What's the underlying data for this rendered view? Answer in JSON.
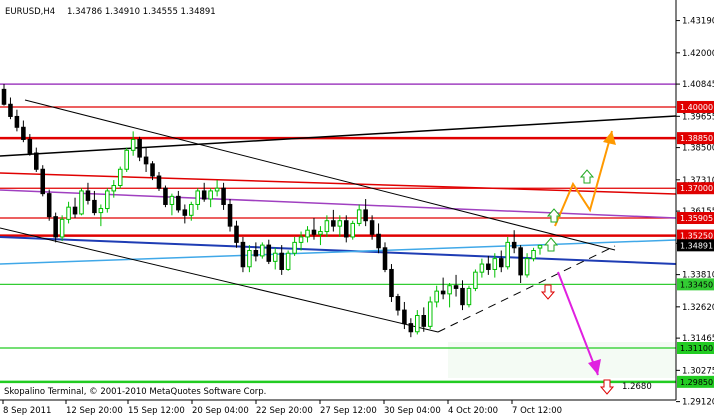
{
  "window": {
    "symbol_tf": "EURUSD,H4",
    "ohlc": "1.34786 1.34910 1.34555 1.34891",
    "copyright": "Skopalino Terminal, © 2001-2010 MetaQuotes Software Corp."
  },
  "colors": {
    "background": "#ffffff",
    "axis": "#000000",
    "bull_candle": "#00c000",
    "bear_candle": "#000000",
    "resistance_red": "#e00000",
    "purple_channel": "#a040c0",
    "blue_line": "#1e3cb4",
    "light_blue_line": "#40a8e8",
    "support_green": "#33cc33",
    "bold_green": "#22cc22",
    "orange_path": "#ff9900",
    "magenta_path": "#e020e0",
    "green_arrow": "#22aa22",
    "red_arrow": "#dd0000",
    "target_zone_fill": "#f4fbf4"
  },
  "chart_data": {
    "type": "candlestick",
    "symbol": "EURUSD",
    "timeframe": "H4",
    "ylim": [
      1.2918,
      1.4395
    ],
    "y_ticks": [
      "1.43190",
      "1.42000",
      "1.40845",
      "1.39655",
      "1.38500",
      "1.37310",
      "1.36155",
      "1.34965",
      "1.33810",
      "1.32620",
      "1.31465",
      "1.30275",
      "1.29120"
    ],
    "x_ticks": [
      "8 Sep 2011",
      "12 Sep 20:00",
      "15 Sep 12:00",
      "20 Sep 04:00",
      "22 Sep 20:00",
      "27 Sep 12:00",
      "30 Sep 04:00",
      "4 Oct 20:00",
      "7 Oct 12:00"
    ],
    "candles": [
      [
        1.4065,
        1.4085,
        1.4005,
        1.401
      ],
      [
        1.401,
        1.4035,
        1.3955,
        1.3965
      ],
      [
        1.3965,
        1.399,
        1.391,
        1.3925
      ],
      [
        1.3925,
        1.395,
        1.387,
        1.388
      ],
      [
        1.388,
        1.39,
        1.382,
        1.383
      ],
      [
        1.383,
        1.385,
        1.376,
        1.377
      ],
      [
        1.377,
        1.3785,
        1.367,
        1.368
      ],
      [
        1.368,
        1.3695,
        1.358,
        1.3595
      ],
      [
        1.3595,
        1.361,
        1.35,
        1.352
      ],
      [
        1.352,
        1.36,
        1.3505,
        1.3585
      ],
      [
        1.3585,
        1.365,
        1.357,
        1.363
      ],
      [
        1.363,
        1.3665,
        1.359,
        1.3605
      ],
      [
        1.3605,
        1.37,
        1.36,
        1.369
      ],
      [
        1.369,
        1.372,
        1.364,
        1.3655
      ],
      [
        1.3655,
        1.369,
        1.36,
        1.361
      ],
      [
        1.361,
        1.364,
        1.356,
        1.3625
      ],
      [
        1.3625,
        1.37,
        1.361,
        1.369
      ],
      [
        1.369,
        1.373,
        1.3665,
        1.371
      ],
      [
        1.371,
        1.378,
        1.37,
        1.377
      ],
      [
        1.377,
        1.385,
        1.376,
        1.384
      ],
      [
        1.384,
        1.391,
        1.382,
        1.388
      ],
      [
        1.388,
        1.389,
        1.38,
        1.3815
      ],
      [
        1.3815,
        1.385,
        1.376,
        1.379
      ],
      [
        1.379,
        1.38,
        1.373,
        1.3745
      ],
      [
        1.3745,
        1.376,
        1.369,
        1.37
      ],
      [
        1.37,
        1.371,
        1.363,
        1.364
      ],
      [
        1.364,
        1.368,
        1.36,
        1.367
      ],
      [
        1.367,
        1.369,
        1.361,
        1.362
      ],
      [
        1.362,
        1.364,
        1.357,
        1.36
      ],
      [
        1.36,
        1.365,
        1.358,
        1.364
      ],
      [
        1.364,
        1.37,
        1.362,
        1.369
      ],
      [
        1.369,
        1.372,
        1.365,
        1.366
      ],
      [
        1.366,
        1.37,
        1.363,
        1.369
      ],
      [
        1.369,
        1.373,
        1.367,
        1.37
      ],
      [
        1.37,
        1.372,
        1.362,
        1.364
      ],
      [
        1.364,
        1.366,
        1.354,
        1.356
      ],
      [
        1.356,
        1.358,
        1.348,
        1.35
      ],
      [
        1.35,
        1.352,
        1.339,
        1.341
      ],
      [
        1.341,
        1.349,
        1.339,
        1.347
      ],
      [
        1.347,
        1.35,
        1.343,
        1.345
      ],
      [
        1.345,
        1.35,
        1.344,
        1.349
      ],
      [
        1.349,
        1.351,
        1.342,
        1.343
      ],
      [
        1.343,
        1.348,
        1.34,
        1.346
      ],
      [
        1.346,
        1.349,
        1.338,
        1.34
      ],
      [
        1.34,
        1.347,
        1.3395,
        1.346
      ],
      [
        1.346,
        1.352,
        1.345,
        1.35
      ],
      [
        1.35,
        1.354,
        1.347,
        1.352
      ],
      [
        1.352,
        1.356,
        1.35,
        1.3545
      ],
      [
        1.3545,
        1.359,
        1.351,
        1.353
      ],
      [
        1.353,
        1.356,
        1.349,
        1.354
      ],
      [
        1.354,
        1.36,
        1.352,
        1.358
      ],
      [
        1.358,
        1.362,
        1.354,
        1.356
      ],
      [
        1.356,
        1.36,
        1.352,
        1.358
      ],
      [
        1.358,
        1.36,
        1.35,
        1.352
      ],
      [
        1.352,
        1.358,
        1.351,
        1.357
      ],
      [
        1.357,
        1.364,
        1.356,
        1.362
      ],
      [
        1.362,
        1.366,
        1.356,
        1.358
      ],
      [
        1.358,
        1.36,
        1.351,
        1.353
      ],
      [
        1.353,
        1.357,
        1.346,
        1.348
      ],
      [
        1.348,
        1.35,
        1.339,
        1.34
      ],
      [
        1.34,
        1.342,
        1.328,
        1.33
      ],
      [
        1.33,
        1.331,
        1.323,
        1.325
      ],
      [
        1.325,
        1.328,
        1.318,
        1.32
      ],
      [
        1.32,
        1.322,
        1.315,
        1.317
      ],
      [
        1.317,
        1.325,
        1.316,
        1.323
      ],
      [
        1.323,
        1.326,
        1.317,
        1.319
      ],
      [
        1.319,
        1.33,
        1.318,
        1.328
      ],
      [
        1.328,
        1.334,
        1.326,
        1.332
      ],
      [
        1.332,
        1.337,
        1.329,
        1.331
      ],
      [
        1.331,
        1.335,
        1.326,
        1.334
      ],
      [
        1.334,
        1.338,
        1.33,
        1.333
      ],
      [
        1.333,
        1.336,
        1.325,
        1.327
      ],
      [
        1.327,
        1.334,
        1.326,
        1.333
      ],
      [
        1.333,
        1.34,
        1.332,
        1.339
      ],
      [
        1.339,
        1.344,
        1.337,
        1.342
      ],
      [
        1.342,
        1.345,
        1.338,
        1.34
      ],
      [
        1.34,
        1.346,
        1.337,
        1.344
      ],
      [
        1.344,
        1.347,
        1.339,
        1.341
      ],
      [
        1.341,
        1.352,
        1.34,
        1.35
      ],
      [
        1.35,
        1.3545,
        1.346,
        1.348
      ],
      [
        1.348,
        1.349,
        1.335,
        1.338
      ],
      [
        1.338,
        1.346,
        1.337,
        1.344
      ],
      [
        1.344,
        1.348,
        1.343,
        1.347
      ],
      [
        1.3479,
        1.3491,
        1.3455,
        1.3489
      ]
    ],
    "price_levels": [
      {
        "price": 1.4,
        "label": "1.40000",
        "color": "#e00000"
      },
      {
        "price": 1.3885,
        "label": "1.38850",
        "color": "#e00000"
      },
      {
        "price": 1.37,
        "label": "1.37000",
        "color": "#e00000"
      },
      {
        "price": 1.359,
        "label": "1.35905",
        "color": "#e00000"
      },
      {
        "price": 1.3525,
        "label": "1.35250",
        "color": "#e00000"
      },
      {
        "price": 1.34891,
        "label": "1.34891",
        "color": "#000000"
      },
      {
        "price": 1.3345,
        "label": "1.33450",
        "color": "#33cc33"
      },
      {
        "price": 1.311,
        "label": "1.31100",
        "color": "#22cc22"
      },
      {
        "price": 1.2985,
        "label": "1.29850",
        "color": "#22cc22"
      }
    ],
    "target_label": "1.2680"
  }
}
